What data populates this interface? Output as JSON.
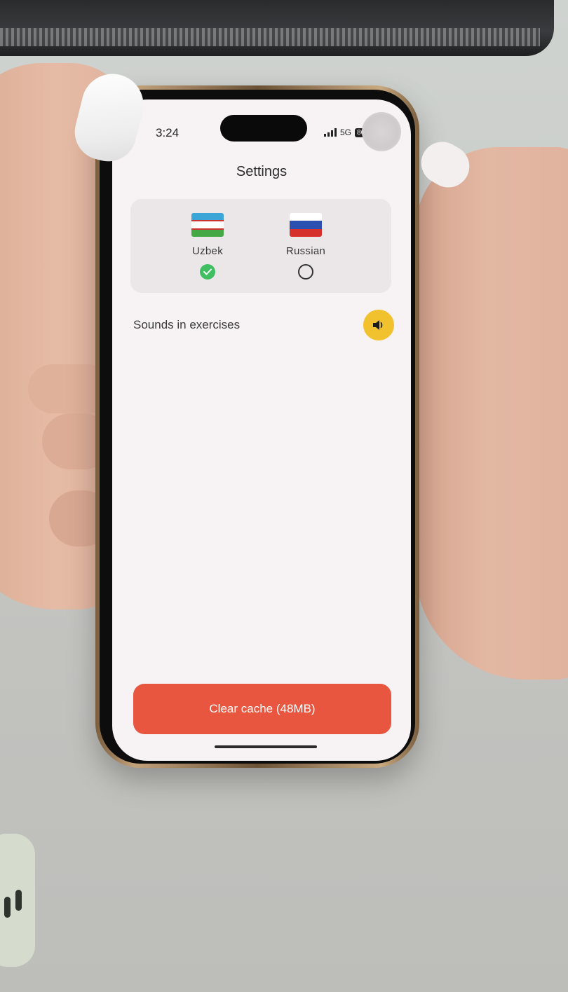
{
  "status_bar": {
    "time": "3:24",
    "network": "5G",
    "battery": "86"
  },
  "header": {
    "title": "Settings"
  },
  "languages": {
    "options": [
      {
        "label": "Uzbek",
        "selected": true
      },
      {
        "label": "Russian",
        "selected": false
      }
    ]
  },
  "sounds": {
    "label": "Sounds in exercises",
    "enabled": true
  },
  "actions": {
    "clear_cache_label": "Clear cache (48MB)"
  },
  "colors": {
    "accent_red": "#e85640",
    "toggle_yellow": "#f2c12e",
    "check_green": "#3fbf62",
    "screen_bg": "#f7f2f4",
    "card_bg": "#ebe6e8"
  },
  "icons": {
    "signal": "signal-icon",
    "battery": "battery-icon",
    "speaker": "speaker-icon",
    "check": "check-icon"
  }
}
